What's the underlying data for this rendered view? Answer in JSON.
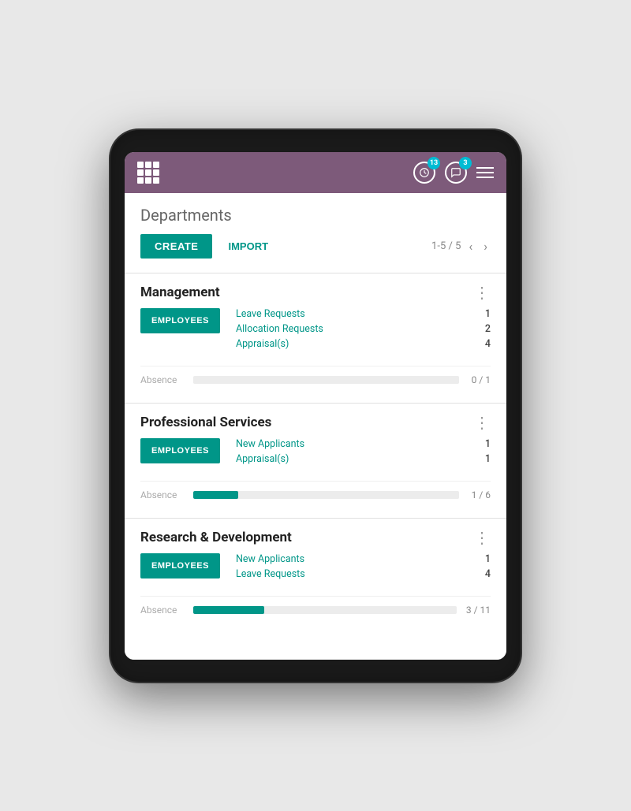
{
  "header": {
    "grid_icon": "grid-icon",
    "notifications_badge": "13",
    "messages_badge": "3",
    "hamburger": "menu"
  },
  "page": {
    "title": "Departments",
    "toolbar": {
      "create_label": "CREATE",
      "import_label": "IMPORT",
      "pagination": "1-5 / 5"
    }
  },
  "departments": [
    {
      "name": "Management",
      "employees_label": "EMPLOYEES",
      "stats": [
        {
          "label": "Leave Requests",
          "value": "1"
        },
        {
          "label": "Allocation Requests",
          "value": "2"
        },
        {
          "label": "Appraisal(s)",
          "value": "4"
        }
      ],
      "absence_label": "Absence",
      "absence_fill_pct": 0,
      "absence_count": "0 / 1"
    },
    {
      "name": "Professional Services",
      "employees_label": "EMPLOYEES",
      "stats": [
        {
          "label": "New Applicants",
          "value": "1"
        },
        {
          "label": "Appraisal(s)",
          "value": "1"
        }
      ],
      "absence_label": "Absence",
      "absence_fill_pct": 17,
      "absence_count": "1 / 6"
    },
    {
      "name": "Research & Development",
      "employees_label": "EMPLOYEES",
      "stats": [
        {
          "label": "New Applicants",
          "value": "1"
        },
        {
          "label": "Leave Requests",
          "value": "4"
        }
      ],
      "absence_label": "Absence",
      "absence_fill_pct": 27,
      "absence_count": "3 / 11"
    }
  ]
}
